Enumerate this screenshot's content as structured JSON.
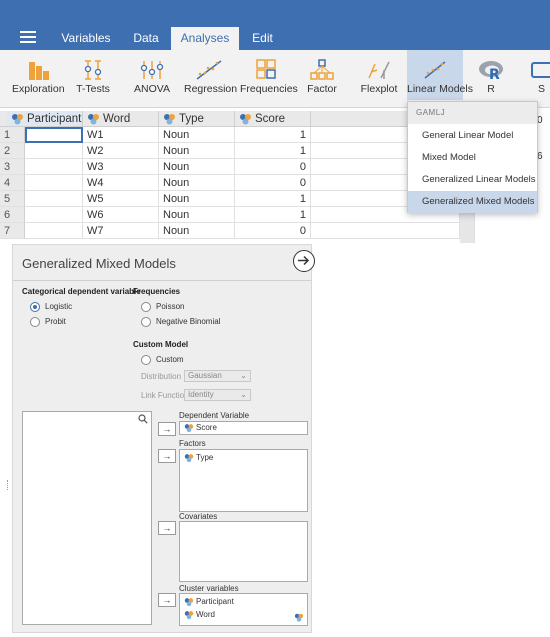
{
  "nav": {
    "tabs": [
      "Variables",
      "Data",
      "Analyses",
      "Edit"
    ],
    "active_tab": "Analyses"
  },
  "ribbon": {
    "items": [
      {
        "label": "Exploration",
        "icon": "bar-chart-icon"
      },
      {
        "label": "T-Tests",
        "icon": "t-test-icon"
      },
      {
        "label": "ANOVA",
        "icon": "anova-icon"
      },
      {
        "label": "Regression",
        "icon": "regression-icon"
      },
      {
        "label": "Frequencies",
        "icon": "frequencies-icon"
      },
      {
        "label": "Factor",
        "icon": "factor-icon"
      },
      {
        "label": "Flexplot",
        "icon": "flexplot-icon"
      },
      {
        "label": "Linear Models",
        "icon": "linear-models-icon"
      },
      {
        "label": "R",
        "icon": "r-logo-icon"
      },
      {
        "label": "S",
        "icon": "s-module-icon"
      }
    ],
    "selected": "Linear Models"
  },
  "grid": {
    "columns": [
      {
        "name": "Participant",
        "type": "nominal"
      },
      {
        "name": "Word",
        "type": "nominal"
      },
      {
        "name": "Type",
        "type": "nominal"
      },
      {
        "name": "Score",
        "type": "nominal"
      }
    ],
    "rows": [
      {
        "n": "1",
        "participant": "",
        "word": "W1",
        "type": "Noun",
        "score": "1"
      },
      {
        "n": "2",
        "participant": "",
        "word": "W2",
        "type": "Noun",
        "score": "1"
      },
      {
        "n": "3",
        "participant": "",
        "word": "W3",
        "type": "Noun",
        "score": "0"
      },
      {
        "n": "4",
        "participant": "",
        "word": "W4",
        "type": "Noun",
        "score": "0"
      },
      {
        "n": "5",
        "participant": "",
        "word": "W5",
        "type": "Noun",
        "score": "1"
      },
      {
        "n": "6",
        "participant": "",
        "word": "W6",
        "type": "Noun",
        "score": "1"
      },
      {
        "n": "7",
        "participant": "",
        "word": "W7",
        "type": "Noun",
        "score": "0"
      }
    ]
  },
  "results_sliver": {
    "chars": [
      "0",
      "6"
    ]
  },
  "menu": {
    "header": "GAMLJ",
    "items": [
      "General Linear Model",
      "Mixed Model",
      "Generalized Linear Models",
      "Generalized Mixed Models"
    ],
    "highlighted": "Generalized Mixed Models"
  },
  "panel": {
    "title": "Generalized Mixed Models",
    "categorical": {
      "heading": "Categorical dependent variable",
      "options": [
        "Logistic",
        "Probit"
      ],
      "selected": "Logistic"
    },
    "frequencies": {
      "heading": "Frequencies",
      "options": [
        "Poisson",
        "Negative Binomial"
      ]
    },
    "custom": {
      "heading": "Custom Model",
      "option": "Custom",
      "distribution_label": "Distribution",
      "distribution_value": "Gaussian",
      "link_label": "Link Function",
      "link_value": "Identity"
    },
    "dependent": {
      "label": "Dependent Variable",
      "value": "Score"
    },
    "factors": {
      "label": "Factors",
      "items": [
        "Type"
      ]
    },
    "covariates": {
      "label": "Covariates",
      "items": []
    },
    "cluster": {
      "label": "Cluster variables",
      "items": [
        "Participant",
        "Word"
      ]
    },
    "move_button": "→"
  },
  "colors": {
    "brand_blue": "#3e6fb0",
    "highlight": "#c9d7eb",
    "ribbon_bg": "#f2f2f2"
  }
}
